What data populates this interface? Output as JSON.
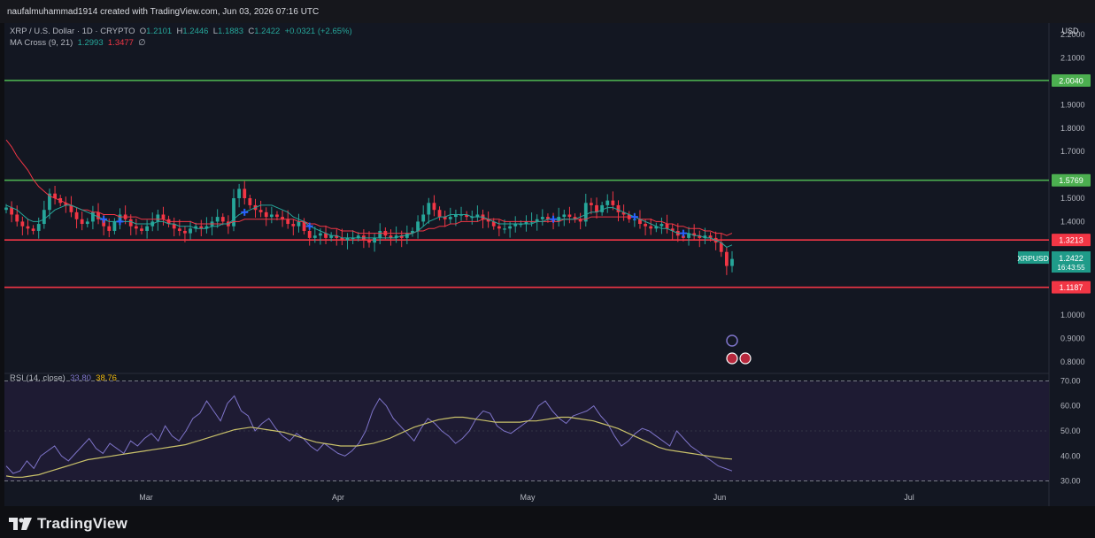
{
  "header": {
    "credit": "naufalmuhammad1914 created with TradingView.com, Jun 03, 2026 07:16 UTC"
  },
  "legend": {
    "symbol": "XRP / U.S. Dollar · 1D · CRYPTO",
    "o_label": "O",
    "o_value": "1.2101",
    "h_label": "H",
    "h_value": "1.2446",
    "l_label": "L",
    "l_value": "1.1883",
    "c_label": "C",
    "c_value": "1.2422",
    "change": "+0.0321 (+2.65%)",
    "ma_label": "MA Cross (9, 21)",
    "ma_fast": "1.2993",
    "ma_slow": "1.3477",
    "ma_suffix": "∅",
    "rsi_label": "RSI (14, close)",
    "rsi_value": "33.80",
    "rsi_ma": "38.76"
  },
  "currency": "USD",
  "footer": {
    "brand": "TradingView"
  },
  "colors": {
    "up": "#26a69a",
    "down": "#f23645",
    "ma_fast": "#26a69a",
    "ma_slow": "#f23645",
    "support": "#f23645",
    "resistance": "#4caf50",
    "rsi": "#7e74c9",
    "rsi_ma": "#c9c16a"
  },
  "chart_data": [
    {
      "type": "candlestick",
      "symbol_label": "XRPUSD",
      "ylim": [
        0.75,
        2.25
      ],
      "y_ticks": [
        "2.2000",
        "2.1000",
        "1.9000",
        "1.8000",
        "1.7000",
        "1.5000",
        "1.4000",
        "1.0000",
        "0.9000",
        "0.8000"
      ],
      "x_ticks": [
        "Mar",
        "Apr",
        "May",
        "Jun",
        "Jul"
      ],
      "hlines": [
        {
          "value": 2.004,
          "label": "2.0040",
          "color": "#4caf50"
        },
        {
          "value": 1.5769,
          "label": "1.5769",
          "color": "#4caf50"
        },
        {
          "value": 1.3213,
          "label": "1.3213",
          "color": "#f23645"
        },
        {
          "value": 1.1187,
          "label": "1.1187",
          "color": "#f23645"
        }
      ],
      "last_price": {
        "label": "1.2422",
        "countdown": "16:43:55"
      },
      "closes": [
        1.46,
        1.43,
        1.4,
        1.38,
        1.37,
        1.36,
        1.39,
        1.45,
        1.52,
        1.5,
        1.48,
        1.47,
        1.44,
        1.41,
        1.39,
        1.4,
        1.44,
        1.41,
        1.38,
        1.36,
        1.4,
        1.43,
        1.41,
        1.38,
        1.37,
        1.36,
        1.38,
        1.4,
        1.43,
        1.41,
        1.39,
        1.37,
        1.36,
        1.35,
        1.37,
        1.38,
        1.37,
        1.38,
        1.4,
        1.42,
        1.4,
        1.38,
        1.5,
        1.54,
        1.5,
        1.47,
        1.45,
        1.44,
        1.42,
        1.43,
        1.42,
        1.41,
        1.39,
        1.38,
        1.4,
        1.36,
        1.33,
        1.34,
        1.35,
        1.33,
        1.34,
        1.33,
        1.32,
        1.33,
        1.33,
        1.34,
        1.32,
        1.31,
        1.33,
        1.36,
        1.34,
        1.33,
        1.34,
        1.33,
        1.35,
        1.36,
        1.4,
        1.43,
        1.48,
        1.45,
        1.42,
        1.41,
        1.42,
        1.43,
        1.43,
        1.42,
        1.42,
        1.43,
        1.41,
        1.4,
        1.38,
        1.37,
        1.37,
        1.38,
        1.39,
        1.39,
        1.4,
        1.4,
        1.41,
        1.42,
        1.41,
        1.4,
        1.42,
        1.43,
        1.42,
        1.41,
        1.4,
        1.48,
        1.47,
        1.44,
        1.47,
        1.49,
        1.47,
        1.44,
        1.43,
        1.41,
        1.41,
        1.39,
        1.38,
        1.37,
        1.38,
        1.39,
        1.37,
        1.36,
        1.34,
        1.33,
        1.35,
        1.34,
        1.33,
        1.34,
        1.33,
        1.31,
        1.27,
        1.21,
        1.24
      ],
      "ma_fast": [
        1.47,
        1.46,
        1.45,
        1.43,
        1.41,
        1.4,
        1.4,
        1.41,
        1.43,
        1.45,
        1.46,
        1.47,
        1.47,
        1.46,
        1.45,
        1.44,
        1.43,
        1.42,
        1.41,
        1.4,
        1.4,
        1.4,
        1.4,
        1.4,
        1.39,
        1.39,
        1.39,
        1.39,
        1.4,
        1.4,
        1.39,
        1.39,
        1.38,
        1.38,
        1.38,
        1.37,
        1.37,
        1.37,
        1.38,
        1.38,
        1.39,
        1.39,
        1.41,
        1.43,
        1.44,
        1.45,
        1.46,
        1.47,
        1.47,
        1.47,
        1.46,
        1.45,
        1.44,
        1.42,
        1.41,
        1.4,
        1.38,
        1.37,
        1.36,
        1.35,
        1.34,
        1.34,
        1.33,
        1.33,
        1.33,
        1.33,
        1.33,
        1.33,
        1.33,
        1.33,
        1.33,
        1.33,
        1.33,
        1.34,
        1.34,
        1.35,
        1.36,
        1.38,
        1.4,
        1.41,
        1.42,
        1.42,
        1.43,
        1.43,
        1.43,
        1.43,
        1.42,
        1.42,
        1.42,
        1.41,
        1.4,
        1.39,
        1.39,
        1.39,
        1.39,
        1.39,
        1.39,
        1.39,
        1.4,
        1.4,
        1.41,
        1.41,
        1.41,
        1.41,
        1.41,
        1.41,
        1.42,
        1.43,
        1.44,
        1.44,
        1.45,
        1.46,
        1.46,
        1.45,
        1.44,
        1.43,
        1.42,
        1.41,
        1.4,
        1.39,
        1.38,
        1.37,
        1.37,
        1.36,
        1.35,
        1.35,
        1.35,
        1.34,
        1.34,
        1.33,
        1.33,
        1.32,
        1.31,
        1.29,
        1.3
      ],
      "ma_slow": [
        1.75,
        1.72,
        1.68,
        1.65,
        1.62,
        1.58,
        1.55,
        1.53,
        1.51,
        1.5,
        1.49,
        1.48,
        1.47,
        1.46,
        1.45,
        1.45,
        1.44,
        1.44,
        1.43,
        1.43,
        1.43,
        1.42,
        1.42,
        1.42,
        1.42,
        1.41,
        1.41,
        1.41,
        1.41,
        1.41,
        1.4,
        1.4,
        1.4,
        1.4,
        1.4,
        1.39,
        1.39,
        1.39,
        1.39,
        1.39,
        1.39,
        1.39,
        1.4,
        1.4,
        1.41,
        1.41,
        1.41,
        1.41,
        1.41,
        1.41,
        1.41,
        1.41,
        1.41,
        1.41,
        1.4,
        1.4,
        1.39,
        1.39,
        1.38,
        1.38,
        1.37,
        1.37,
        1.36,
        1.36,
        1.36,
        1.35,
        1.35,
        1.35,
        1.35,
        1.35,
        1.35,
        1.35,
        1.35,
        1.35,
        1.35,
        1.35,
        1.36,
        1.36,
        1.37,
        1.37,
        1.38,
        1.38,
        1.39,
        1.39,
        1.4,
        1.4,
        1.4,
        1.4,
        1.41,
        1.41,
        1.41,
        1.41,
        1.4,
        1.4,
        1.4,
        1.4,
        1.4,
        1.4,
        1.4,
        1.4,
        1.4,
        1.4,
        1.4,
        1.41,
        1.41,
        1.41,
        1.41,
        1.41,
        1.42,
        1.42,
        1.42,
        1.42,
        1.42,
        1.42,
        1.42,
        1.42,
        1.42,
        1.41,
        1.41,
        1.41,
        1.4,
        1.4,
        1.39,
        1.39,
        1.38,
        1.38,
        1.37,
        1.37,
        1.37,
        1.36,
        1.36,
        1.35,
        1.35,
        1.34,
        1.35
      ]
    },
    {
      "type": "line",
      "name": "RSI (14, close)",
      "ylim": [
        27,
        73
      ],
      "y_ticks": [
        "70.00",
        "60.00",
        "50.00",
        "40.00",
        "30.00"
      ],
      "bands": {
        "upper": 70,
        "lower": 30
      },
      "series": [
        {
          "name": "RSI",
          "values": [
            36,
            33,
            34,
            38,
            35,
            40,
            42,
            44,
            40,
            38,
            41,
            44,
            47,
            43,
            41,
            45,
            43,
            41,
            46,
            44,
            47,
            49,
            46,
            52,
            48,
            46,
            50,
            55,
            57,
            62,
            58,
            54,
            61,
            64,
            58,
            56,
            50,
            53,
            55,
            51,
            48,
            46,
            49,
            47,
            44,
            42,
            45,
            43,
            41,
            40,
            42,
            45,
            50,
            58,
            63,
            60,
            55,
            52,
            49,
            46,
            51,
            55,
            53,
            50,
            48,
            45,
            47,
            50,
            55,
            58,
            57,
            52,
            50,
            49,
            51,
            53,
            55,
            60,
            62,
            58,
            55,
            53,
            56,
            57,
            58,
            60,
            56,
            53,
            48,
            44,
            46,
            49,
            51,
            50,
            48,
            46,
            44,
            50,
            47,
            44,
            42,
            40,
            38,
            36,
            35,
            34
          ]
        },
        {
          "name": "MA",
          "values": [
            32,
            31.5,
            31.5,
            32,
            32.5,
            33.5,
            34.5,
            35.5,
            36.5,
            37.5,
            38.5,
            39,
            39.5,
            40,
            40.5,
            41,
            41.5,
            42,
            42.5,
            43,
            43.5,
            44,
            44.5,
            45.5,
            46.5,
            47.5,
            48.5,
            49.5,
            50.5,
            51,
            51.5,
            51,
            50.5,
            50,
            49.5,
            48.5,
            47.5,
            46.5,
            45.5,
            45,
            44.5,
            44,
            44,
            44,
            44.5,
            45,
            46,
            47,
            48.5,
            50,
            51.5,
            52.5,
            53.5,
            54.5,
            55,
            55.5,
            55.5,
            55,
            54.5,
            54,
            53.5,
            53.5,
            53.5,
            53.5,
            54,
            54,
            54.5,
            55,
            55.5,
            55.5,
            55,
            54.5,
            54,
            53,
            52,
            51,
            49.5,
            48,
            46.5,
            45,
            43.5,
            42.5,
            42,
            41.5,
            41,
            40.5,
            40,
            39.5,
            39,
            38.76
          ]
        }
      ]
    }
  ]
}
